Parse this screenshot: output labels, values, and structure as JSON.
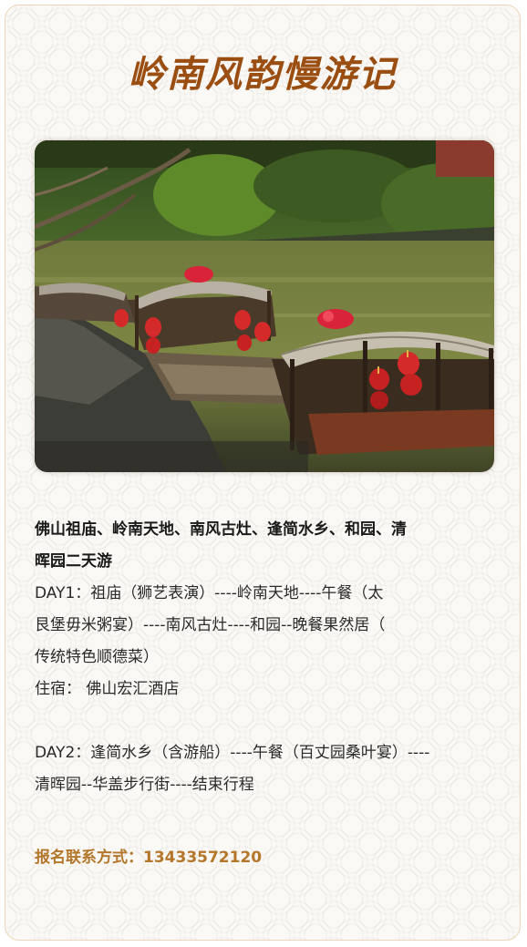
{
  "title": "岭南风韵慢游记",
  "colors": {
    "title": "#9a4e12",
    "contact": "#b4762a",
    "body_text": "#2a2a2a"
  },
  "itinerary": {
    "heading_line1": "佛山祖庙、岭南天地、南风古灶、逢简水乡、和园、清",
    "heading_line2": "晖园二天游",
    "day1_line1": "DAY1：祖庙（狮艺表演）----岭南天地----午餐（太",
    "day1_line2": "艮堡毋米粥宴）----南风古灶----和园--晚餐果然居（",
    "day1_line3": "传统特色顺德菜）",
    "lodging": "住宿： 佛山宏汇酒店",
    "day2_line1": "DAY2：逢简水乡（含游船）----午餐（百丈园桑叶宴）----",
    "day2_line2": "清晖园--华盖步行街----结束行程"
  },
  "contact": {
    "label": "报名联系方式：",
    "phone": "13433572120"
  }
}
